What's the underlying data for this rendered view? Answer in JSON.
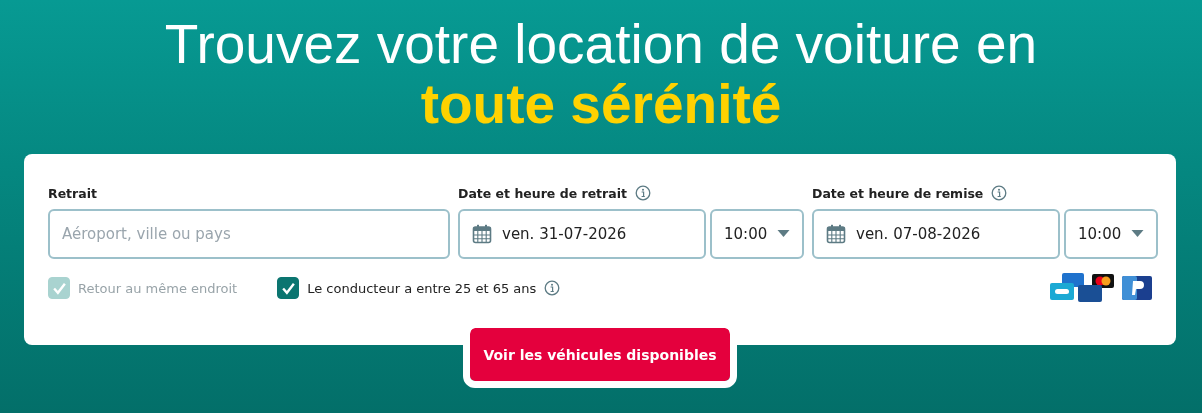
{
  "headline": {
    "line1": "Trouvez votre location de voiture en",
    "line2": "toute sérénité"
  },
  "form": {
    "pickup": {
      "label": "Retrait",
      "placeholder": "Aéroport, ville ou pays"
    },
    "pickup_datetime": {
      "label": "Date et heure de retrait",
      "date": "ven. 31-07-2026",
      "time": "10:00"
    },
    "return_datetime": {
      "label": "Date et heure de remise",
      "date": "ven. 07-08-2026",
      "time": "10:00"
    },
    "checkboxes": [
      {
        "label": "Retour au même endroit",
        "checked": true,
        "disabled": true,
        "info": false
      },
      {
        "label": "Le conducteur a entre 25 et 65 ans",
        "checked": true,
        "disabled": false,
        "info": true
      }
    ],
    "submit": "Voir les véhicules disponibles"
  }
}
